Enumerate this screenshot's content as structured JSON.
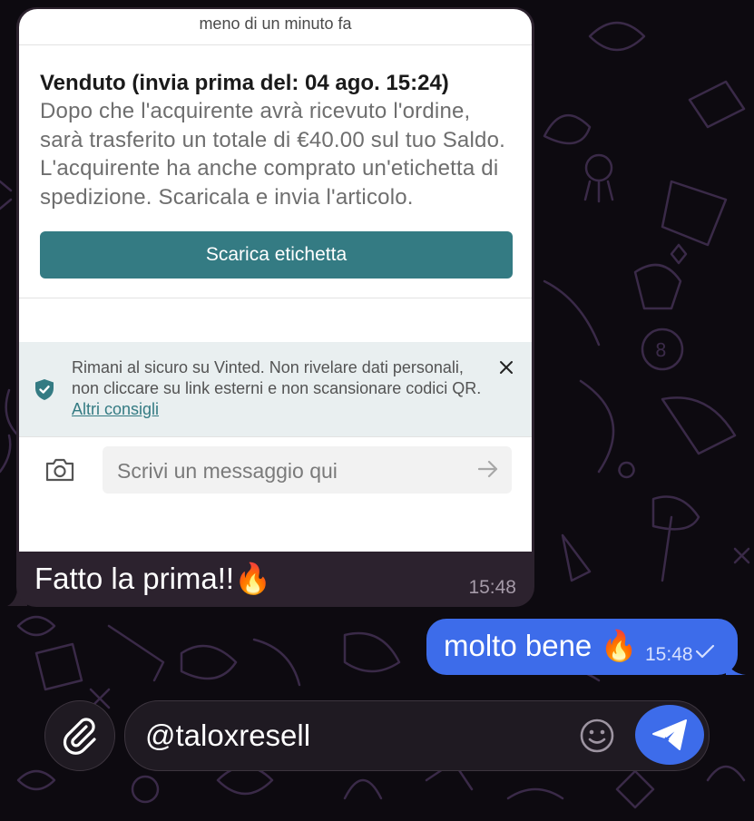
{
  "chat": {
    "incoming": {
      "screenshot": {
        "time_ago": "meno di un minuto fa",
        "sold_title": "Venduto (invia prima del: 04 ago. 15:24)",
        "sold_lines": [
          "Dopo che l'acquirente avrà ricevuto l'ordine,",
          "sarà trasferito un totale di €40.00 sul tuo Saldo.",
          "L'acquirente ha anche comprato un'etichetta di",
          "spedizione. Scaricala e invia l'articolo."
        ],
        "download_button": "Scarica etichetta",
        "safety_lines": [
          "Rimani al sicuro su Vinted. Non rivelare dati personali,",
          "non cliccare su link esterni e non scansionare codici QR."
        ],
        "safety_link": "Altri consigli",
        "message_placeholder": "Scrivi un messaggio qui"
      },
      "caption": "Fatto la prima!!🔥",
      "time": "15:48"
    },
    "outgoing": {
      "text": "molto bene 🔥",
      "time": "15:48"
    }
  },
  "composer": {
    "value": "@taloxresell"
  },
  "colors": {
    "wallpaper": "#0d0a10",
    "incoming_bubble": "#2c222e",
    "outgoing_bubble": "#3d6cea",
    "vinted_teal": "#347b83"
  },
  "icons": {
    "attach": "paperclip-icon",
    "emoji": "smiley-icon",
    "send": "paper-plane-icon",
    "camera": "camera-icon",
    "shield": "shield-check-icon"
  }
}
